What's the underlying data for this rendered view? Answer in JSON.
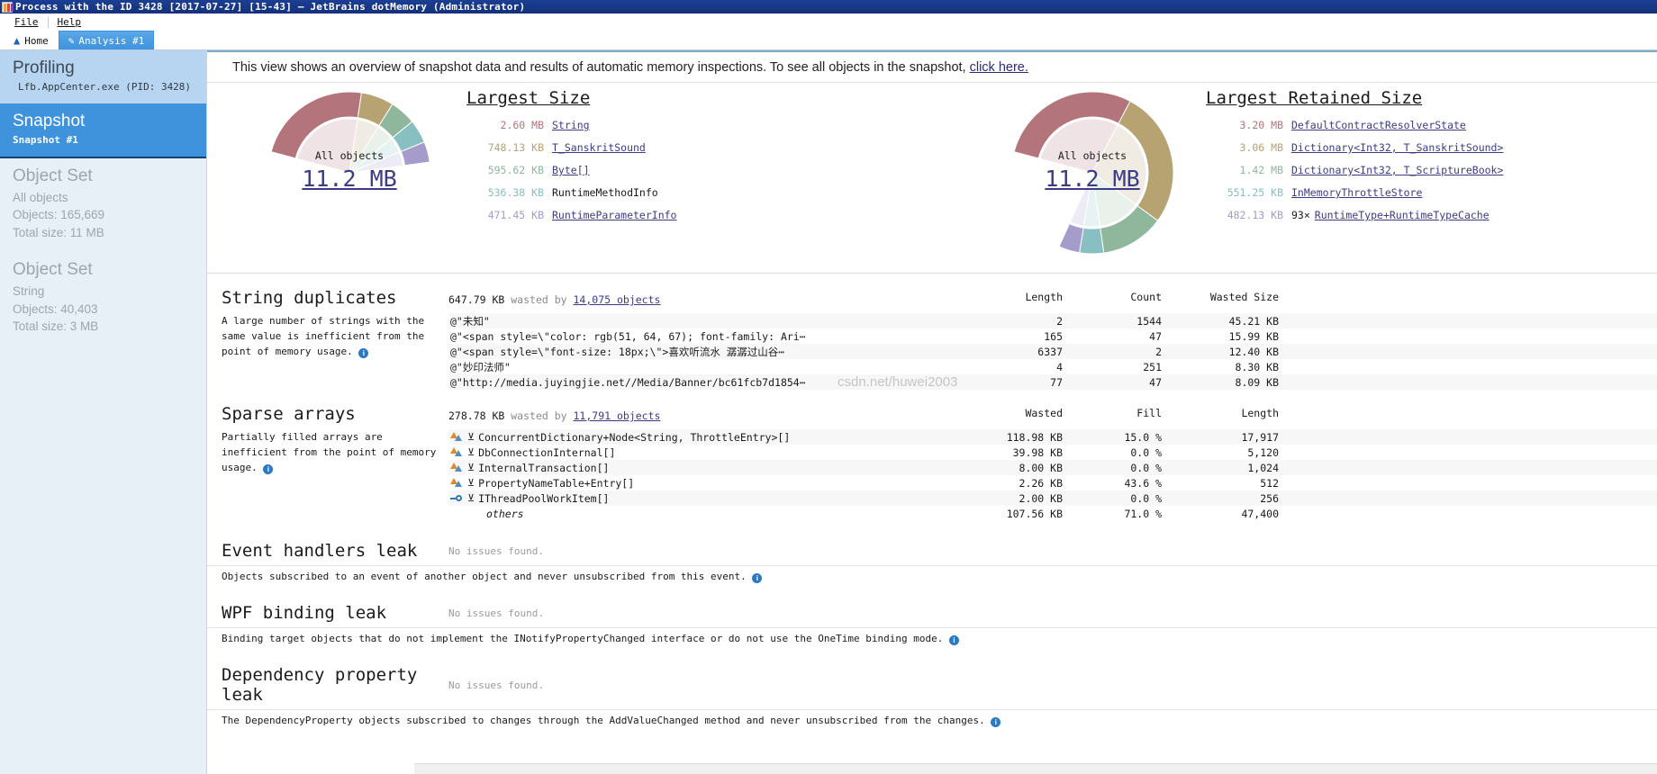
{
  "window": {
    "title": "Process with the ID 3428 [2017-07-27] [15-43] — JetBrains dotMemory (Administrator)",
    "logo_icon": "dotmemory-logo-icon"
  },
  "menu": {
    "items": [
      {
        "label": "File"
      },
      {
        "label": "Help"
      }
    ]
  },
  "tabs": [
    {
      "label": "Home",
      "icon": "home-icon",
      "active": false
    },
    {
      "label": "Analysis #1",
      "icon": "pencil-icon",
      "active": true
    }
  ],
  "sidebar": {
    "profiling": {
      "title": "Profiling",
      "process": "Lfb.AppCenter.exe (PID: 3428)"
    },
    "snapshot": {
      "title": "Snapshot",
      "name": "Snapshot #1"
    },
    "object_sets": [
      {
        "title": "Object Set",
        "name": "All objects",
        "objects": "Objects: 165,669",
        "total": "Total size: 11 MB"
      },
      {
        "title": "Object Set",
        "name": "String",
        "objects": "Objects: 40,403",
        "total": "Total size: 3 MB"
      }
    ]
  },
  "notice": {
    "text": "This view shows an overview of snapshot data and results of automatic memory inspections. To see all objects in the snapshot,",
    "link": "click here."
  },
  "charts": [
    {
      "title": "Largest Size",
      "center_label": "All objects",
      "center_value": "11.2 MB",
      "items": [
        {
          "size": "2.60 MB",
          "name": "String",
          "color": "#b4747b",
          "link": true
        },
        {
          "size": "748.13 KB",
          "name": "T_SanskritSound",
          "color": "#b7a272",
          "link": true
        },
        {
          "size": "595.62 KB",
          "name": "Byte[]",
          "color": "#8fb79b",
          "link": true
        },
        {
          "size": "536.38 KB",
          "name": "RuntimeMethodInfo",
          "color": "#88bfc0",
          "link": false
        },
        {
          "size": "471.45 KB",
          "name": "RuntimeParameterInfo",
          "color": "#a59ccb",
          "link": true
        }
      ],
      "chart_data": {
        "type": "pie",
        "title": "Largest Size",
        "categories": [
          "String",
          "T_SanskritSound",
          "Byte[]",
          "RuntimeMethodInfo",
          "RuntimeParameterInfo",
          "others"
        ],
        "values": [
          2.6,
          0.7306,
          0.5817,
          0.5238,
          0.4604,
          6.3
        ],
        "unit": "MB",
        "colors": [
          "#b4747b",
          "#b7a272",
          "#8fb79b",
          "#88bfc0",
          "#a59ccb",
          "#ffffff"
        ],
        "total": 11.2,
        "legend": "right"
      }
    },
    {
      "title": "Largest Retained Size",
      "center_label": "All objects",
      "center_value": "11.2 MB",
      "items": [
        {
          "size": "3.20 MB",
          "multiplier": "",
          "name": "DefaultContractResolverState",
          "color": "#b4747b",
          "link": true
        },
        {
          "size": "3.06 MB",
          "multiplier": "",
          "name": "Dictionary<Int32, T_SanskritSound>",
          "color": "#b7a272",
          "link": true
        },
        {
          "size": "1.42 MB",
          "multiplier": "",
          "name": "Dictionary<Int32, T_ScriptureBook>",
          "color": "#8fb79b",
          "link": true
        },
        {
          "size": "551.25 KB",
          "multiplier": "",
          "name": "InMemoryThrottleStore",
          "color": "#88bfc0",
          "link": true
        },
        {
          "size": "482.13 KB",
          "multiplier": "93×",
          "name": "RuntimeType+RuntimeTypeCache",
          "color": "#a59ccb",
          "link": true
        }
      ],
      "chart_data": {
        "type": "pie",
        "title": "Largest Retained Size",
        "categories": [
          "DefaultContractResolverState",
          "Dictionary<Int32, T_SanskritSound>",
          "Dictionary<Int32, T_ScriptureBook>",
          "InMemoryThrottleStore",
          "RuntimeType+RuntimeTypeCache",
          "others"
        ],
        "values": [
          3.2,
          3.06,
          1.42,
          0.5383,
          0.4708,
          2.51
        ],
        "unit": "MB",
        "colors": [
          "#b4747b",
          "#b7a272",
          "#8fb79b",
          "#88bfc0",
          "#a59ccb",
          "#ffffff"
        ],
        "total": 11.2,
        "legend": "right"
      }
    }
  ],
  "sections": [
    {
      "id": "string-duplicates",
      "title": "String duplicates",
      "summary_size": "647.79 KB",
      "summary_mid": "wasted by",
      "summary_link": "14,075 objects",
      "description": "A large number of strings with the same value is inefficient from the point of memory usage.",
      "columns": [
        "Length",
        "Count",
        "Wasted Size"
      ],
      "rows": [
        {
          "name": "@\"未知\"",
          "cells": [
            "2",
            "1544",
            "45.21 KB"
          ]
        },
        {
          "name": "@\"<span style=\\\"color: rgb(51, 64, 67); font-family: Ari⋯",
          "cells": [
            "165",
            "47",
            "15.99 KB"
          ]
        },
        {
          "name": "@\"<span style=\\\"font-size: 18px;\\\">喜欢听流水 潺潺过山谷⋯",
          "cells": [
            "6337",
            "2",
            "12.40 KB"
          ]
        },
        {
          "name": "@\"妙印法师\"",
          "cells": [
            "4",
            "251",
            "8.30 KB"
          ]
        },
        {
          "name": "@\"http://media.juyingjie.net//Media/Banner/bc61fcb7d1854⋯",
          "cells": [
            "77",
            "47",
            "8.09 KB"
          ]
        }
      ]
    },
    {
      "id": "sparse-arrays",
      "title": "Sparse arrays",
      "summary_size": "278.78 KB",
      "summary_mid": "wasted by",
      "summary_link": "11,791 objects",
      "description": "Partially filled arrays are inefficient from the point of memory usage.",
      "columns": [
        "Wasted",
        "Fill",
        "Length"
      ],
      "rows": [
        {
          "icon": "array-type-icon",
          "name": "ConcurrentDictionary+Node<String, ThrottleEntry>[]",
          "cells": [
            "118.98 KB",
            "15.0 %",
            "17,917"
          ]
        },
        {
          "icon": "array-type-icon",
          "name": "DbConnectionInternal[]",
          "cells": [
            "39.98 KB",
            "0.0 %",
            "5,120"
          ]
        },
        {
          "icon": "array-type-icon",
          "name": "InternalTransaction[]",
          "cells": [
            "8.00 KB",
            "0.0 %",
            "1,024"
          ]
        },
        {
          "icon": "array-type-icon",
          "name": "PropertyNameTable+Entry[]",
          "cells": [
            "2.26 KB",
            "43.6 %",
            "512"
          ]
        },
        {
          "icon": "interface-type-icon",
          "name": "IThreadPoolWorkItem[]",
          "cells": [
            "2.00 KB",
            "0.0 %",
            "256"
          ]
        },
        {
          "icon": "",
          "name": "others",
          "cells": [
            "107.56 KB",
            "71.0 %",
            "47,400"
          ],
          "others": true
        }
      ]
    }
  ],
  "leaks": [
    {
      "id": "event-handlers-leak",
      "title": "Event handlers leak",
      "status": "No issues found.",
      "note": "Objects subscribed to an event of another object and never unsubscribed from this event."
    },
    {
      "id": "wpf-binding-leak",
      "title": "WPF binding leak",
      "status": "No issues found.",
      "note": "Binding target objects that do not implement the INotifyPropertyChanged interface or do not use the OneTime binding mode."
    },
    {
      "id": "dependency-property-leak",
      "title": "Dependency property leak",
      "status": "No issues found.",
      "note": "The DependencyProperty objects subscribed to changes through the AddValueChanged method and never unsubscribed from the changes."
    }
  ],
  "watermark": "csdn.net/huwei2003"
}
